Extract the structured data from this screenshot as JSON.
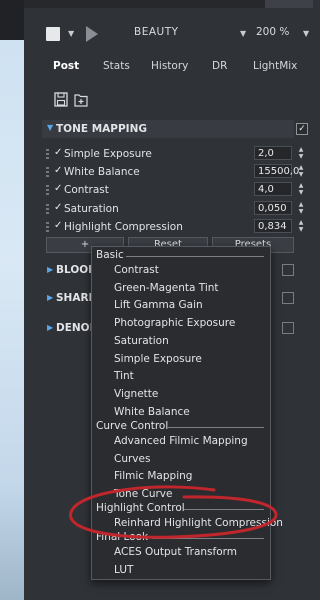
{
  "toolbar": {
    "render_element": "BEAUTY",
    "zoom": "200 %"
  },
  "tabs": [
    "Post",
    "Stats",
    "History",
    "DR",
    "LightMix"
  ],
  "tone_mapping": {
    "title": "TONE MAPPING",
    "enabled": true,
    "properties": [
      {
        "label": "Simple Exposure",
        "value": "2,0",
        "checked": true
      },
      {
        "label": "White Balance",
        "value": "15500,0",
        "checked": true
      },
      {
        "label": "Contrast",
        "value": "4,0",
        "checked": true
      },
      {
        "label": "Saturation",
        "value": "0,050",
        "checked": true
      },
      {
        "label": "Highlight Compression",
        "value": "0,834",
        "checked": true
      }
    ],
    "buttons": {
      "add": "+",
      "reset": "Reset",
      "presets": "Presets"
    }
  },
  "sections": [
    {
      "title": "BLOOM"
    },
    {
      "title": "SHARPE"
    },
    {
      "title": "DENOIS"
    }
  ],
  "menu": {
    "groups": [
      {
        "label": "Basic",
        "items": [
          "Contrast",
          "Green-Magenta Tint",
          "Lift Gamma Gain",
          "Photographic Exposure",
          "Saturation",
          "Simple Exposure",
          "Tint",
          "Vignette",
          "White Balance"
        ]
      },
      {
        "label": "Curve Control",
        "items": [
          "Advanced Filmic Mapping",
          "Curves",
          "Filmic Mapping",
          "Tone Curve"
        ]
      },
      {
        "label": "Highlight Control",
        "items": [
          "Reinhard Highlight Compression"
        ]
      },
      {
        "label": "Final Look",
        "items": [
          "ACES Output Transform",
          "LUT"
        ]
      }
    ]
  },
  "annotation_color": "#c0262c"
}
